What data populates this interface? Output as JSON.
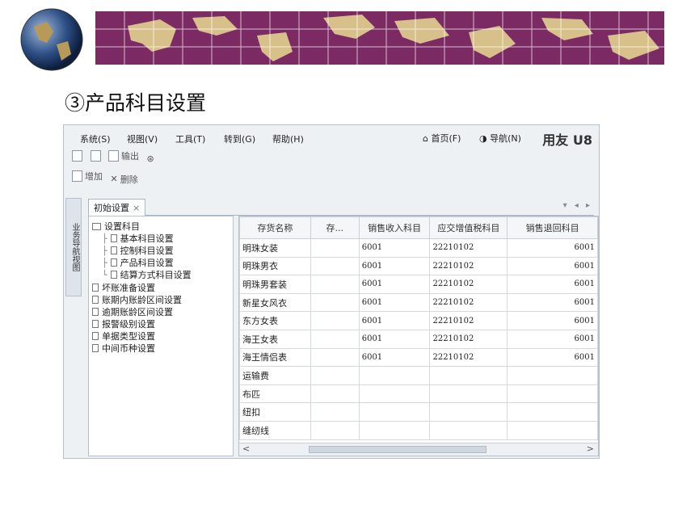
{
  "slide_title": "③产品科目设置",
  "app": {
    "menu": [
      "系统(S)",
      "视图(V)",
      "工具(T)",
      "转到(G)",
      "帮助(H)"
    ],
    "right_links": [
      "首页(F)",
      "导航(N)"
    ],
    "brand": "用友 U8",
    "toolbar1": {
      "output_label": "输出"
    },
    "toolbar2": {
      "add_label": "增加",
      "delete_label": "删除"
    },
    "side_nav_label": "业务导航视图",
    "tab": {
      "label": "初始设置",
      "close": "×"
    },
    "tab_nav": "▾ ◂ ▸",
    "tree": {
      "root": "设置科目",
      "children": [
        "基本科目设置",
        "控制科目设置",
        "产品科目设置",
        "结算方式科目设置"
      ],
      "others": [
        "坏账准备设置",
        "账期内账龄区间设置",
        "逾期账龄区间设置",
        "报警级别设置",
        "单据类型设置",
        "中间币种设置"
      ]
    },
    "grid": {
      "columns": [
        "存货名称",
        "存...",
        "销售收入科目",
        "应交增值税科目",
        "销售退回科目"
      ],
      "rows": [
        [
          "明珠女装",
          "",
          "6001",
          "22210102",
          "6001"
        ],
        [
          "明珠男衣",
          "",
          "6001",
          "22210102",
          "6001"
        ],
        [
          "明珠男套装",
          "",
          "6001",
          "22210102",
          "6001"
        ],
        [
          "新星女风衣",
          "",
          "6001",
          "22210102",
          "6001"
        ],
        [
          "东方女表",
          "",
          "6001",
          "22210102",
          "6001"
        ],
        [
          "海王女表",
          "",
          "6001",
          "22210102",
          "6001"
        ],
        [
          "海王情侣表",
          "",
          "6001",
          "22210102",
          "6001"
        ],
        [
          "运输费",
          "",
          "",
          "",
          ""
        ],
        [
          "布匹",
          "",
          "",
          "",
          ""
        ],
        [
          "纽扣",
          "",
          "",
          "",
          ""
        ],
        [
          "缝纫线",
          "",
          "",
          "",
          ""
        ]
      ]
    },
    "scroll": {
      "left": "<",
      "right": ">"
    }
  }
}
